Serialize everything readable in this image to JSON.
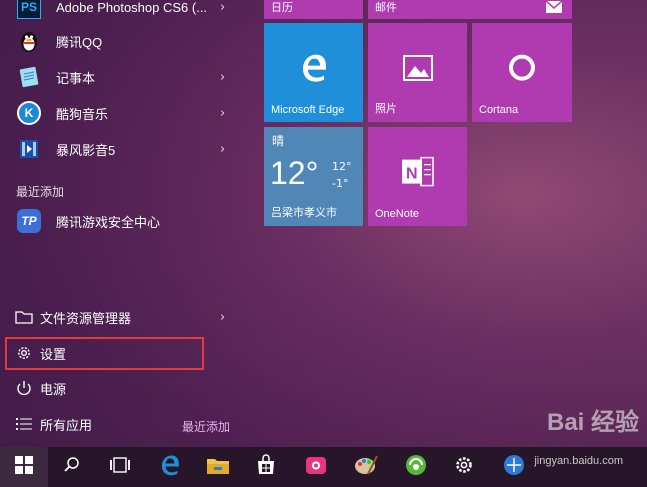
{
  "apps": [
    {
      "label": "Adobe Photoshop CS6 (...",
      "icon": "photoshop-icon",
      "icon_text": "PS",
      "chevron": "›"
    },
    {
      "label": "腾讯QQ",
      "icon": "qq-penguin-icon",
      "chevron": ""
    },
    {
      "label": "记事本",
      "icon": "notepad-icon",
      "chevron": "›"
    },
    {
      "label": "酷狗音乐",
      "icon": "kugou-icon",
      "icon_text": "K",
      "chevron": "›"
    },
    {
      "label": "暴风影音5",
      "icon": "baofeng-icon",
      "chevron": "›"
    }
  ],
  "recent_section": {
    "heading": "最近添加"
  },
  "recent_apps": [
    {
      "label": "腾讯游戏安全中心",
      "icon": "tencent-game-security-icon",
      "icon_text": "TP"
    }
  ],
  "system_items": [
    {
      "label": "文件资源管理器",
      "icon": "file-explorer-icon",
      "chevron": "›"
    },
    {
      "label": "设置",
      "icon": "gear-icon",
      "chevron": ""
    },
    {
      "label": "电源",
      "icon": "power-icon",
      "chevron": ""
    },
    {
      "label": "所有应用",
      "icon": "all-apps-icon",
      "chevron": ""
    }
  ],
  "recent_link": "最近添加",
  "tiles": {
    "calendar": {
      "label": "日历"
    },
    "mail": {
      "label": "邮件"
    },
    "edge": {
      "label": "Microsoft Edge"
    },
    "photos": {
      "label": "照片"
    },
    "cortana": {
      "label": "Cortana"
    },
    "weather": {
      "condition": "晴",
      "temp": "12°",
      "high": "12°",
      "low": "-1°",
      "city": "吕梁市孝义市"
    },
    "onenote": {
      "label": "OneNote",
      "icon_text": "N"
    }
  },
  "colors": {
    "tile_purple": "#b03ab0",
    "edge_blue": "#1e8fd8",
    "weather_blue": "#5087b6",
    "highlight_red": "#e23b3b"
  },
  "taskbar": {
    "items": [
      "windows-start-icon",
      "search-icon",
      "task-view-icon",
      "edge-icon",
      "file-explorer-icon",
      "store-icon",
      "app-icon",
      "paint-icon",
      "green-app-icon",
      "gear-icon",
      "browser-icon"
    ]
  },
  "watermark": {
    "text": "Bai 经验",
    "url": "jingyan.baidu.com"
  }
}
